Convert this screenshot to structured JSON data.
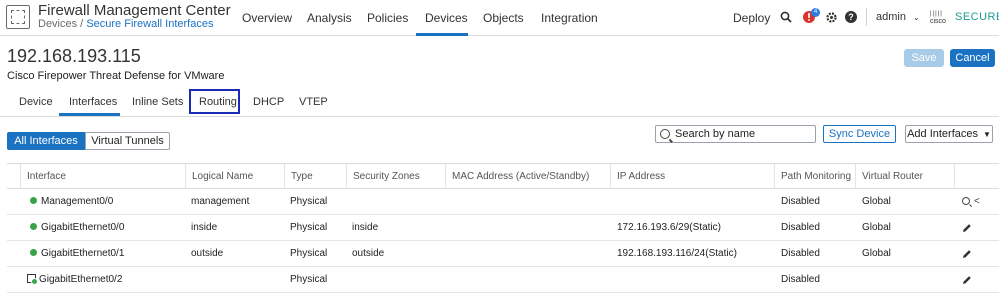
{
  "header": {
    "app_title": "Firewall Management Center",
    "breadcrumb_root": "Devices /",
    "breadcrumb_current": "Secure Firewall Interfaces",
    "nav": [
      "Overview",
      "Analysis",
      "Policies",
      "Devices",
      "Objects",
      "Integration"
    ],
    "active_nav": "Devices",
    "deploy_label": "Deploy",
    "alert_count": "4",
    "user_label": "admin",
    "brand_cisco": "cisco",
    "brand_secure": "SECURE"
  },
  "device": {
    "ip": "192.168.193.115",
    "model": "Cisco Firepower Threat Defense for VMware",
    "save_label": "Save",
    "cancel_label": "Cancel"
  },
  "tabs": {
    "items": [
      "Device",
      "Interfaces",
      "Inline Sets",
      "Routing",
      "DHCP",
      "VTEP"
    ],
    "active": "Interfaces",
    "highlighted": "Routing"
  },
  "toolbar": {
    "segment_all": "All Interfaces",
    "segment_virtual": "Virtual Tunnels",
    "search_placeholder": "Search by name",
    "sync_label": "Sync Device",
    "add_label": "Add Interfaces"
  },
  "table": {
    "columns": [
      "Interface",
      "Logical Name",
      "Type",
      "Security Zones",
      "MAC Address (Active/Standby)",
      "IP Address",
      "Path Monitoring",
      "Virtual Router"
    ],
    "rows": [
      {
        "interface": "Management0/0",
        "logical_name": "management",
        "type": "Physical",
        "zones": "",
        "mac": "",
        "ip": "",
        "path_monitoring": "Disabled",
        "virtual_router": "Global",
        "icon": "status-dot"
      },
      {
        "interface": "GigabitEthernet0/0",
        "logical_name": "inside",
        "type": "Physical",
        "zones": "inside",
        "mac": "",
        "ip": "172.16.193.6/29(Static)",
        "path_monitoring": "Disabled",
        "virtual_router": "Global",
        "icon": "status-dot"
      },
      {
        "interface": "GigabitEthernet0/1",
        "logical_name": "outside",
        "type": "Physical",
        "zones": "outside",
        "mac": "",
        "ip": "192.168.193.116/24(Static)",
        "path_monitoring": "Disabled",
        "virtual_router": "Global",
        "icon": "status-dot"
      },
      {
        "interface": "GigabitEthernet0/2",
        "logical_name": "",
        "type": "Physical",
        "zones": "",
        "mac": "",
        "ip": "",
        "path_monitoring": "Disabled",
        "virtual_router": "",
        "icon": "interface-icon"
      }
    ]
  },
  "colors": {
    "accent": "#1b72c3",
    "status_up": "#3aa34a",
    "brand_secure": "#1d9d8e"
  }
}
